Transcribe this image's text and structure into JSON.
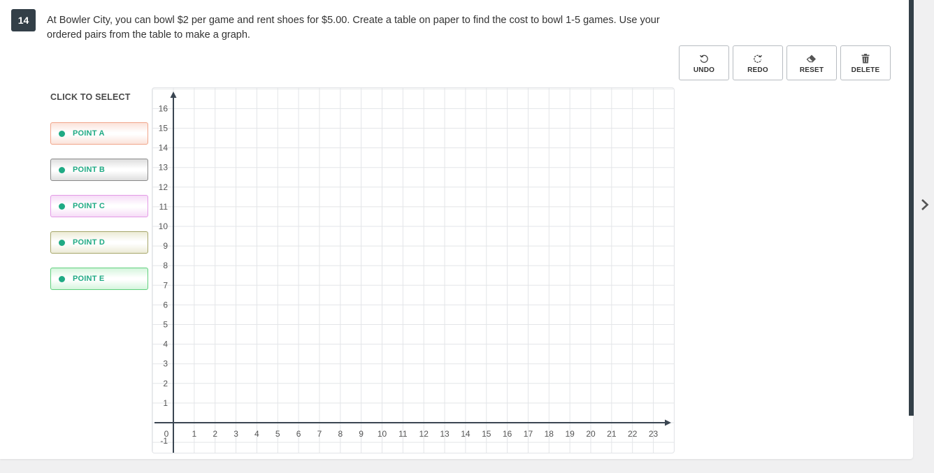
{
  "question": {
    "number": "14",
    "text": "At Bowler City, you can bowl $2 per game and rent shoes for $5.00.  Create a table on paper to find the cost to bowl 1-5 games.  Use your ordered pairs from the table to make a graph."
  },
  "toolbar": {
    "undo_label": "UNDO",
    "redo_label": "REDO",
    "reset_label": "RESET",
    "delete_label": "DELETE"
  },
  "select_panel": {
    "title": "CLICK TO SELECT",
    "points": [
      {
        "label": "POINT A",
        "color": "#f0a58a",
        "bg_from": "#fbe3da"
      },
      {
        "label": "POINT B",
        "color": "#8a8a8a",
        "bg_from": "#dedede"
      },
      {
        "label": "POINT C",
        "color": "#e39be6",
        "bg_from": "#f6dcf7"
      },
      {
        "label": "POINT D",
        "color": "#a6a66a",
        "bg_from": "#ecebd6"
      },
      {
        "label": "POINT E",
        "color": "#5fcf7c",
        "bg_from": "#d5f5dd"
      }
    ]
  },
  "chart_data": {
    "type": "scatter",
    "x_ticks": [
      0,
      1,
      2,
      3,
      4,
      5,
      6,
      7,
      8,
      9,
      10,
      11,
      12,
      13,
      14,
      15,
      16,
      17,
      18,
      19,
      20,
      21,
      22,
      23
    ],
    "y_ticks": [
      -1,
      1,
      2,
      3,
      4,
      5,
      6,
      7,
      8,
      9,
      10,
      11,
      12,
      13,
      14,
      15,
      16
    ],
    "xlim": [
      -1,
      24
    ],
    "ylim": [
      -1.5,
      17
    ],
    "grid": true,
    "series": []
  },
  "colors": {
    "accent": "#1faa84",
    "badge": "#333f48",
    "axis": "#3b4652",
    "grid": "#e3e5e8"
  }
}
